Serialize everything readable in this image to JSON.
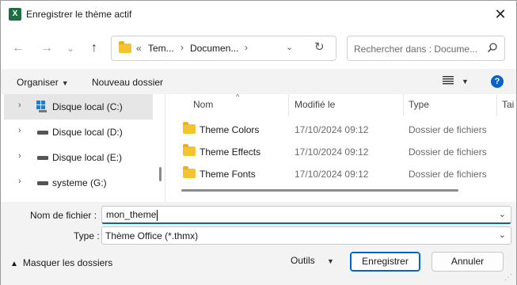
{
  "window": {
    "title": "Enregistrer le thème actif",
    "app_icon_letter": "X",
    "close_glyph": "✕"
  },
  "nav": {
    "back": "←",
    "forward": "→",
    "recent": "⌄",
    "up": "↑",
    "address": {
      "overflow": "«",
      "crumbs": [
        "Tem...",
        "Documen..."
      ],
      "separator": "›",
      "dropdown": "⌄",
      "refresh": "↻"
    },
    "search_placeholder": "Rechercher dans : Docume..."
  },
  "toolbar": {
    "organize_label": "Organiser",
    "new_folder_label": "Nouveau dossier",
    "view_icon": "view-list-icon",
    "help_glyph": "?"
  },
  "sidebar": {
    "items": [
      {
        "label": "Disque local (C:)",
        "icon": "windows-drive-icon",
        "selected": true
      },
      {
        "label": "Disque local (D:)",
        "icon": "drive-icon",
        "selected": false
      },
      {
        "label": "Disque local (E:)",
        "icon": "drive-icon",
        "selected": false
      },
      {
        "label": "systeme (G:)",
        "icon": "drive-icon",
        "selected": false
      }
    ]
  },
  "files": {
    "columns": {
      "name": "Nom",
      "modified": "Modifié le",
      "type": "Type",
      "size": "Tai"
    },
    "rows": [
      {
        "name": "Theme Colors",
        "modified": "17/10/2024 09:12",
        "type": "Dossier de fichiers"
      },
      {
        "name": "Theme Effects",
        "modified": "17/10/2024 09:12",
        "type": "Dossier de fichiers"
      },
      {
        "name": "Theme Fonts",
        "modified": "17/10/2024 09:12",
        "type": "Dossier de fichiers"
      }
    ]
  },
  "form": {
    "filename_label": "Nom de fichier :",
    "filename_value": "mon_theme",
    "filetype_label": "Type :",
    "filetype_value": "Thème Office (*.thmx)"
  },
  "footer": {
    "hide_folders_label": "Masquer les dossiers",
    "tools_label": "Outils",
    "save_label": "Enregistrer",
    "cancel_label": "Annuler"
  },
  "colors": {
    "accent": "#0067c0",
    "folder": "#f4c430",
    "excel": "#1d6f42"
  }
}
